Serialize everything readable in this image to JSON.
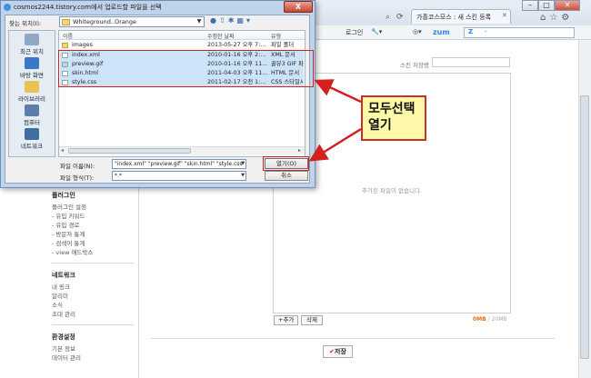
{
  "browser": {
    "tab_title": "가흘코스모스 : 새 스킨 등록",
    "toolbar_login": "로그인",
    "zum_label": "zum",
    "search_prefix": "Z",
    "search_suffix": "-"
  },
  "dialog": {
    "title": "cosmos2244.tistory.com에서 업로드할 파일을 선택",
    "close_label": "X",
    "look_in_label": "찾는 위치(I):",
    "look_in_value": "Whiteground..Orange",
    "places": [
      {
        "label": "최근 위치",
        "icon": "recent-places-icon"
      },
      {
        "label": "바탕 화면",
        "icon": "desktop-icon"
      },
      {
        "label": "라이브러리",
        "icon": "libraries-icon"
      },
      {
        "label": "컴퓨터",
        "icon": "computer-icon"
      },
      {
        "label": "네트워크",
        "icon": "network-icon"
      }
    ],
    "columns": {
      "name": "이름",
      "modified": "수정한 날짜",
      "type": "유형"
    },
    "files": [
      {
        "name": "images",
        "modified": "2013-05-27 오후 7:...",
        "type": "파일 폴더",
        "folder": true,
        "selected": false
      },
      {
        "name": "index.xml",
        "modified": "2010-01-16 오후 2:...",
        "type": "XML 문서",
        "folder": false,
        "selected": true
      },
      {
        "name": "preview.gif",
        "modified": "2010-01-16 오후 11...",
        "type": "꿀뷰3 GIF 파일",
        "folder": false,
        "selected": true
      },
      {
        "name": "skin.html",
        "modified": "2011-04-03 오후 11...",
        "type": "HTML 문서",
        "folder": false,
        "selected": true
      },
      {
        "name": "style.css",
        "modified": "2011-02-17 오전 1:...",
        "type": "CSS 스타일시트",
        "folder": false,
        "selected": true
      }
    ],
    "filename_label": "파일 이름(N):",
    "filename_value": "\"index.xml\" \"preview.gif\" \"skin.html\" \"style.css\"",
    "filetype_label": "파일 형식(T):",
    "filetype_value": "*.*",
    "open_label": "열기(O)",
    "cancel_label": "취소"
  },
  "annotation": {
    "line1": "모두선택",
    "line2": "열기",
    "color": "#d42020"
  },
  "page": {
    "skin_name_label": "스킨 저장명",
    "no_file_text": "추가된 파일이 없습니다.",
    "add_button": "+추가",
    "delete_button": "삭제",
    "size_used": "0MB",
    "size_total": "/ 20MB",
    "save_button": "저장",
    "sidebar": [
      {
        "heading": "플러그인",
        "items": [
          "플러그인 설정",
          "- 유입 키워드",
          "- 유입 경로",
          "- 방문자 통계",
          "- 검색어 통계",
          "- view 애드박스"
        ]
      },
      {
        "heading": "네트워크",
        "items": [
          "내 링크",
          "알리미",
          "소식",
          "초대 관리"
        ]
      },
      {
        "heading": "환경설정",
        "items": [
          "기본 정보",
          "데이터 관리"
        ]
      }
    ]
  }
}
